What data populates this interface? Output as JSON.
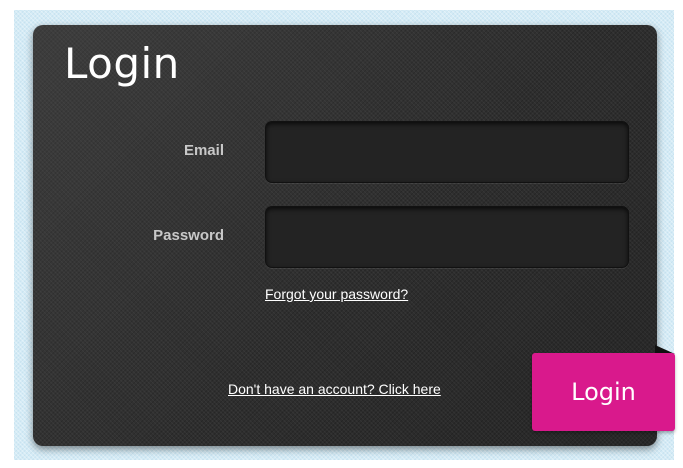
{
  "login_form": {
    "title": "Login",
    "email_label": "Email",
    "email_value": "",
    "password_label": "Password",
    "password_value": "",
    "forgot_password_link": "Forgot your password?",
    "signup_link": "Don't have an account? Click here",
    "login_button": "Login"
  },
  "colors": {
    "panel_background": "#2e2e2e",
    "page_background": "#d4ebf6",
    "accent_button": "#d9198c",
    "label_text": "#c8c8c8",
    "link_text": "#ffffff"
  }
}
